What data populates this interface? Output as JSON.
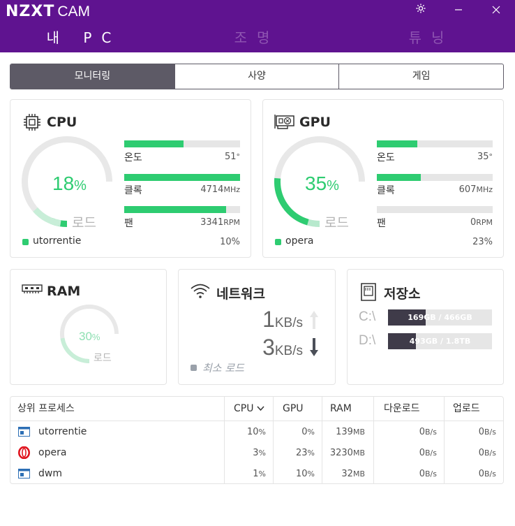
{
  "app": {
    "logo_brand": "NZXT",
    "logo_product": "CAM"
  },
  "nav": {
    "tabs": [
      "내 PC",
      "조명",
      "튜닝"
    ]
  },
  "segments": [
    "모니터링",
    "사양",
    "게임"
  ],
  "cpu": {
    "title": "CPU",
    "load_pct": "18",
    "load_unit": "%",
    "load_fraction": 0.18,
    "load_label": "로드",
    "metrics": [
      {
        "label": "온도",
        "value": "51",
        "unit": "°",
        "fill": 0.51
      },
      {
        "label": "클록",
        "value": "4714",
        "unit": "MHz",
        "fill": 1.0
      },
      {
        "label": "팬",
        "value": "3341",
        "unit": "RPM",
        "fill": 0.88
      }
    ],
    "top_process": "utorrentie",
    "top_process_pct": "10",
    "top_process_unit": "%"
  },
  "gpu": {
    "title": "GPU",
    "load_pct": "35",
    "load_unit": "%",
    "load_fraction": 0.35,
    "load_label": "로드",
    "metrics": [
      {
        "label": "온도",
        "value": "35",
        "unit": "°",
        "fill": 0.35
      },
      {
        "label": "클록",
        "value": "607",
        "unit": "MHz",
        "fill": 0.38
      },
      {
        "label": "팬",
        "value": "0",
        "unit": "RPM",
        "fill": 0.0
      }
    ],
    "top_process": "opera",
    "top_process_pct": "23",
    "top_process_unit": "%"
  },
  "ram": {
    "title": "RAM",
    "load_pct": "30",
    "load_unit": "%",
    "load_fraction": 0.3,
    "load_label": "로드"
  },
  "network": {
    "title": "네트워크",
    "up_value": "1",
    "up_unit": "KB/s",
    "down_value": "3",
    "down_unit": "KB/s",
    "load_label": "최소 로드"
  },
  "storage": {
    "title": "저장소",
    "drives": [
      {
        "label": "C:\\",
        "text": "169GB / 466GB",
        "fill": 0.363
      },
      {
        "label": "D:\\",
        "text": "493GB / 1.8TB",
        "fill": 0.27
      }
    ]
  },
  "processes": {
    "title": "상위 프로세스",
    "headers": [
      "CPU",
      "GPU",
      "RAM",
      "다운로드",
      "업로드"
    ],
    "rows": [
      {
        "name": "utorrentie",
        "icon": "app-window-icon",
        "cpu": "10",
        "gpu": "0",
        "ram": "139",
        "down": "0",
        "up": "0"
      },
      {
        "name": "opera",
        "icon": "opera-icon",
        "cpu": "3",
        "gpu": "23",
        "ram": "3230",
        "down": "0",
        "up": "0"
      },
      {
        "name": "dwm",
        "icon": "app-window-icon",
        "cpu": "1",
        "gpu": "10",
        "ram": "32",
        "down": "0",
        "up": "0"
      }
    ],
    "units": {
      "pct": "%",
      "ram": "MB",
      "net": "B/s"
    }
  },
  "colors": {
    "header": "#5f1390",
    "accent": "#2ecc71",
    "segment_active": "#5d5a66",
    "storage_fill": "#3f3b49"
  }
}
